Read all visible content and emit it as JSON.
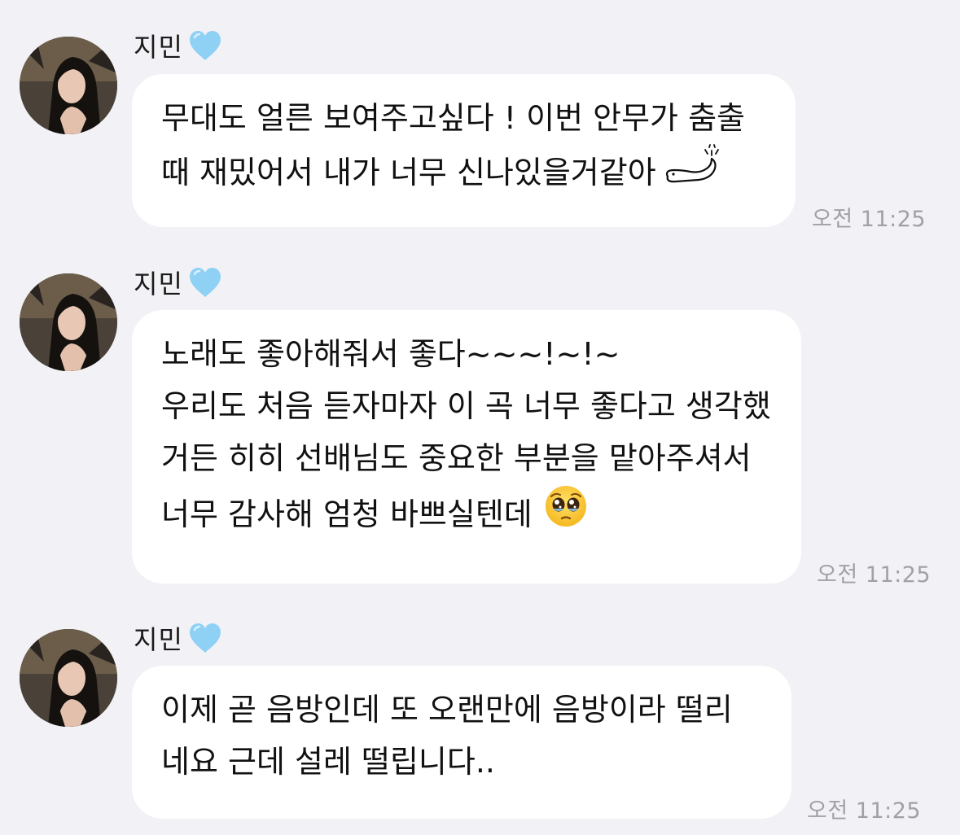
{
  "messages": [
    {
      "sender": "지민",
      "sender_badge": "light-blue-heart-icon",
      "lines": [
        "무대도 얼른 보여주고싶다 ! 이번 안무가 춤출",
        "때 재밌어서 내가 너무 신나있을거같아"
      ],
      "trailing_icon": "wriggling-worm-doodle-icon",
      "time": "오전 11:25"
    },
    {
      "sender": "지민",
      "sender_badge": "light-blue-heart-icon",
      "lines": [
        "노래도 좋아해줘서 좋다~~~!~!~",
        "우리도 처음 듣자마자 이 곡 너무 좋다고 생각했",
        "거든 히히 선배님도 중요한 부분을 맡아주셔서",
        "너무 감사해 엄청 바쁘실텐데"
      ],
      "trailing_icon": "pleading-face-emoji-icon",
      "time": "오전 11:25"
    },
    {
      "sender": "지민",
      "sender_badge": "light-blue-heart-icon",
      "lines": [
        "이제 곧 음방인데 또 오랜만에 음방이라 떨리",
        "네요 근데 설레 떨립니다.."
      ],
      "time": "오전 11:25"
    }
  ],
  "colors": {
    "background": "#f2f2f6",
    "bubble": "#ffffff",
    "text": "#111111",
    "timestamp": "#a0a0a6",
    "heart": "#8fd0f5"
  }
}
